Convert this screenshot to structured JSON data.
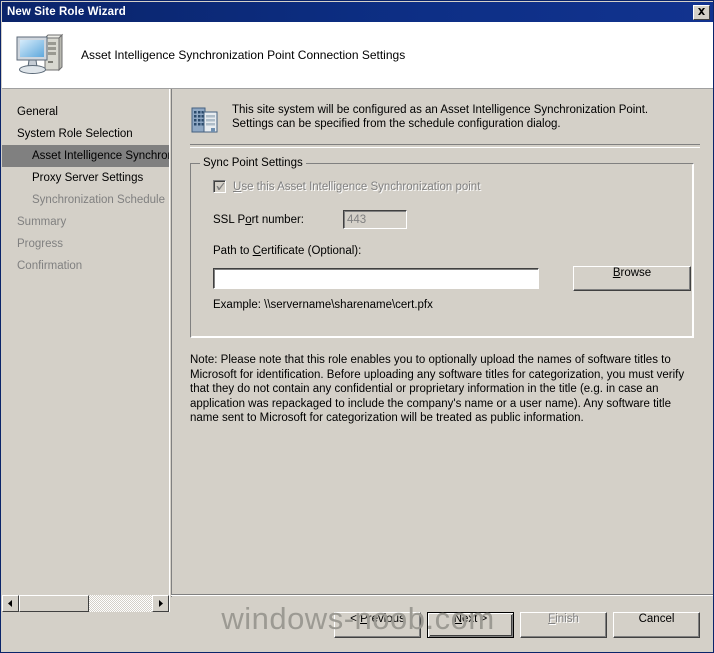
{
  "window": {
    "title": "New Site Role Wizard",
    "close_label": "x",
    "close_icon": "close-icon"
  },
  "header": {
    "icon": "computer-icon",
    "title": "Asset Intelligence Synchronization Point Connection Settings"
  },
  "sidebar": {
    "items": [
      {
        "label": "General",
        "indent": false,
        "selected": false,
        "dim": false
      },
      {
        "label": "System Role Selection",
        "indent": false,
        "selected": false,
        "dim": false
      },
      {
        "label": "Asset Intelligence Synchron",
        "indent": true,
        "selected": true,
        "dim": false
      },
      {
        "label": "Proxy Server Settings",
        "indent": true,
        "selected": false,
        "dim": false
      },
      {
        "label": "Synchronization Schedule",
        "indent": true,
        "selected": false,
        "dim": true
      },
      {
        "label": "Summary",
        "indent": false,
        "selected": false,
        "dim": true
      },
      {
        "label": "Progress",
        "indent": false,
        "selected": false,
        "dim": true
      },
      {
        "label": "Confirmation",
        "indent": false,
        "selected": false,
        "dim": true
      }
    ],
    "scrollbar": {
      "left_arrow": "◄",
      "right_arrow": "►"
    }
  },
  "content": {
    "description_icon": "building-icon",
    "description": "This site system will be configured as an Asset Intelligence Synchronization Point. Settings can be specified from the schedule configuration dialog.",
    "groupbox": {
      "title": "Sync Point Settings",
      "checkbox": {
        "label_prefix": "U",
        "label_rest": "se this Asset Intelligence Synchronization point",
        "checked": true,
        "disabled": true
      },
      "ssl_port": {
        "label_prefix": "SSL P",
        "label_accel": "o",
        "label_rest": "rt number:",
        "value": "443",
        "disabled": true
      },
      "cert_path": {
        "label_prefix": "Path to ",
        "label_accel": "C",
        "label_rest": "ertificate (Optional):",
        "value": "",
        "placeholder": "",
        "browse_label_accel": "B",
        "browse_label_rest": "rowse"
      },
      "example": "Example: \\\\servername\\sharename\\cert.pfx"
    },
    "note": "Note: Please note that this role enables you to optionally upload the names of software titles to Microsoft for identification. Before uploading any software titles for categorization, you must verify that they do not contain any confidential or proprietary information in the title (e.g. in case an application was repackaged to include the company's name or a user name). Any software title name sent to Microsoft for categorization will be treated as public information."
  },
  "buttons": {
    "previous": {
      "prefix": "< ",
      "accel": "P",
      "rest": "revious",
      "disabled": false,
      "default": false
    },
    "next": {
      "prefix": "",
      "accel": "N",
      "rest": "ext >",
      "disabled": false,
      "default": true
    },
    "finish": {
      "prefix": "",
      "accel": "F",
      "rest": "inish",
      "disabled": true,
      "default": false
    },
    "cancel": {
      "prefix": "",
      "accel": "",
      "rest": "Cancel",
      "disabled": false,
      "default": false
    }
  },
  "watermark": {
    "text": "windows-noob.com",
    "color": "#9c9a93"
  }
}
